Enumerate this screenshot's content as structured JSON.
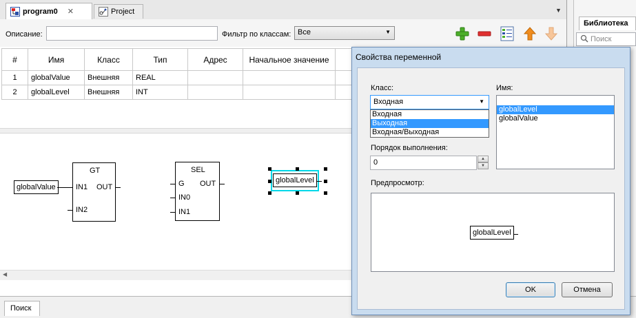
{
  "tabs": [
    {
      "label": "program0",
      "active": true
    },
    {
      "label": "Project",
      "active": false
    }
  ],
  "toolbar": {
    "description_label": "Описание:",
    "description_value": "",
    "filter_label": "Фильтр по классам:",
    "filter_value": "Все"
  },
  "table": {
    "headers": [
      "#",
      "Имя",
      "Класс",
      "Тип",
      "Адрес",
      "Начальное значение"
    ],
    "rows": [
      {
        "num": "1",
        "name": "globalValue",
        "class": "Внешняя",
        "type": "REAL",
        "address": "",
        "initial": ""
      },
      {
        "num": "2",
        "name": "globalLevel",
        "class": "Внешняя",
        "type": "INT",
        "address": "",
        "initial": ""
      }
    ]
  },
  "diagram": {
    "var_in": "globalValue",
    "gt": {
      "title": "GT",
      "in1": "IN1",
      "in2": "IN2",
      "out": "OUT"
    },
    "sel": {
      "title": "SEL",
      "g": "G",
      "in0": "IN0",
      "in1": "IN1",
      "out": "OUT"
    },
    "var_selected": "globalLevel"
  },
  "bottom": {
    "search_tab": "Поиск"
  },
  "library": {
    "tab": "Библиотека",
    "search_placeholder": "Поиск"
  },
  "dialog": {
    "title": "Свойства переменной",
    "class_label": "Класс:",
    "class_value": "Входная",
    "class_options": [
      {
        "label": "Входная",
        "selected": false
      },
      {
        "label": "Выходная",
        "selected": true
      },
      {
        "label": "Входная/Выходная",
        "selected": false
      }
    ],
    "name_label": "Имя:",
    "names": [
      {
        "label": "globalLevel",
        "selected": true
      },
      {
        "label": "globalValue",
        "selected": false
      }
    ],
    "order_label": "Порядок выполнения:",
    "order_value": "0",
    "preview_label": "Предпросмотр:",
    "preview_var": "globalLevel",
    "ok": "OK",
    "cancel": "Отмена"
  },
  "colors": {
    "selection": "#3399ff",
    "add": "#4caf2a",
    "remove": "#e03030",
    "arrow": "#f08c1e",
    "selected_outline": "#00d8e8"
  }
}
